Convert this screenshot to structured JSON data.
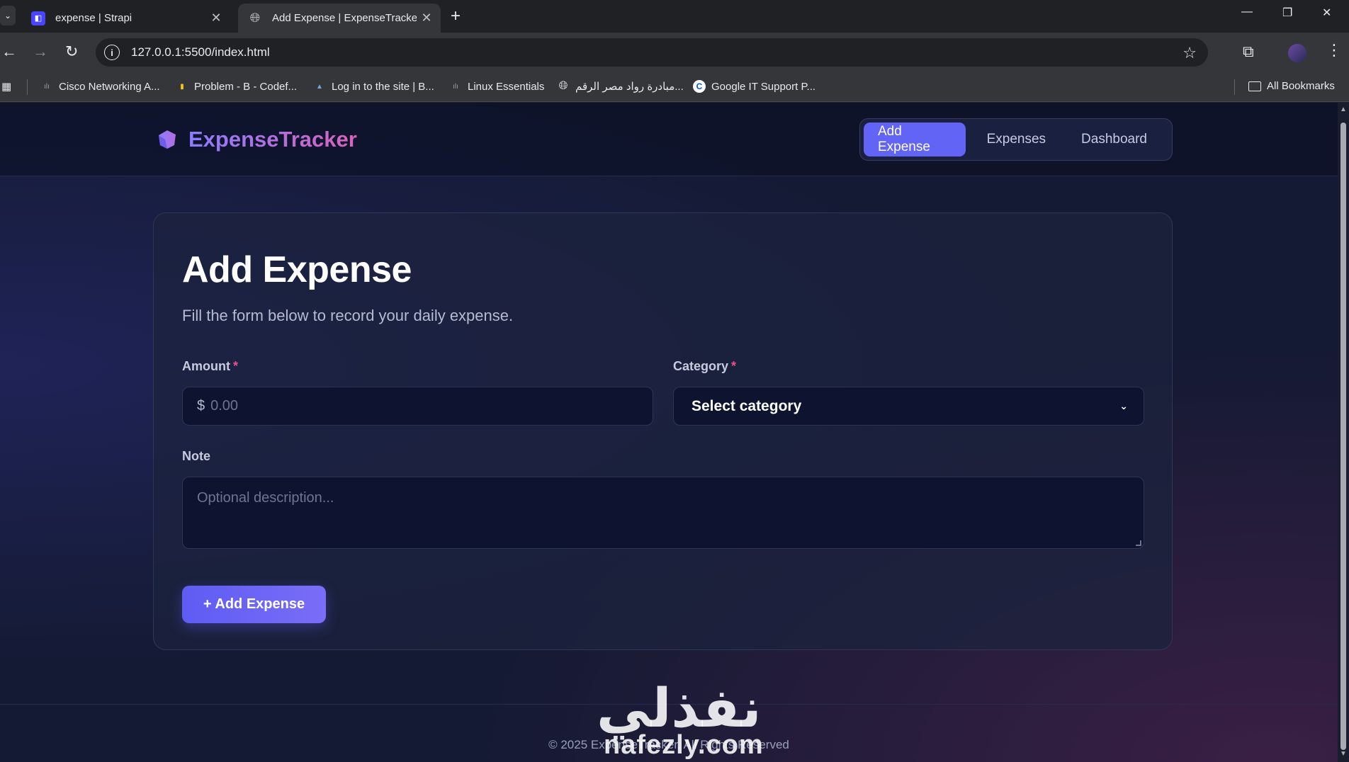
{
  "browser": {
    "tabs": [
      {
        "title": "expense | Strapi",
        "active": false
      },
      {
        "title": "Add Expense | ExpenseTracker",
        "active": true
      }
    ],
    "url": "127.0.0.1:5500/index.html",
    "bookmarks": [
      {
        "label": "Cisco Networking A..."
      },
      {
        "label": "Problem - B - Codef..."
      },
      {
        "label": "Log in to the site | B..."
      },
      {
        "label": "Linux Essentials"
      },
      {
        "label": "مبادرة رواد مصر الرقم..."
      },
      {
        "label": "Google IT Support P..."
      }
    ],
    "all_bookmarks": "All Bookmarks"
  },
  "site": {
    "brand": "ExpenseTracker",
    "nav": [
      {
        "label": "Add Expense",
        "active": true
      },
      {
        "label": "Expenses",
        "active": false
      },
      {
        "label": "Dashboard",
        "active": false
      }
    ]
  },
  "form": {
    "title": "Add Expense",
    "subtitle": "Fill the form below to record your daily expense.",
    "amount": {
      "label": "Amount",
      "required": "*",
      "currency": "$",
      "placeholder": "0.00",
      "value": ""
    },
    "category": {
      "label": "Category",
      "required": "*",
      "selected": "Select category"
    },
    "note": {
      "label": "Note",
      "placeholder": "Optional description...",
      "value": ""
    },
    "submit_label": "+ Add Expense"
  },
  "footer": {
    "text": "© 2025 ExpenseTracker. All Rights Reserved"
  },
  "watermark": {
    "arabic": "نفذلي",
    "latin": "nafezly.com"
  },
  "colors": {
    "accent": "#6264f5",
    "required": "#f04f86",
    "background": "#141a33"
  }
}
